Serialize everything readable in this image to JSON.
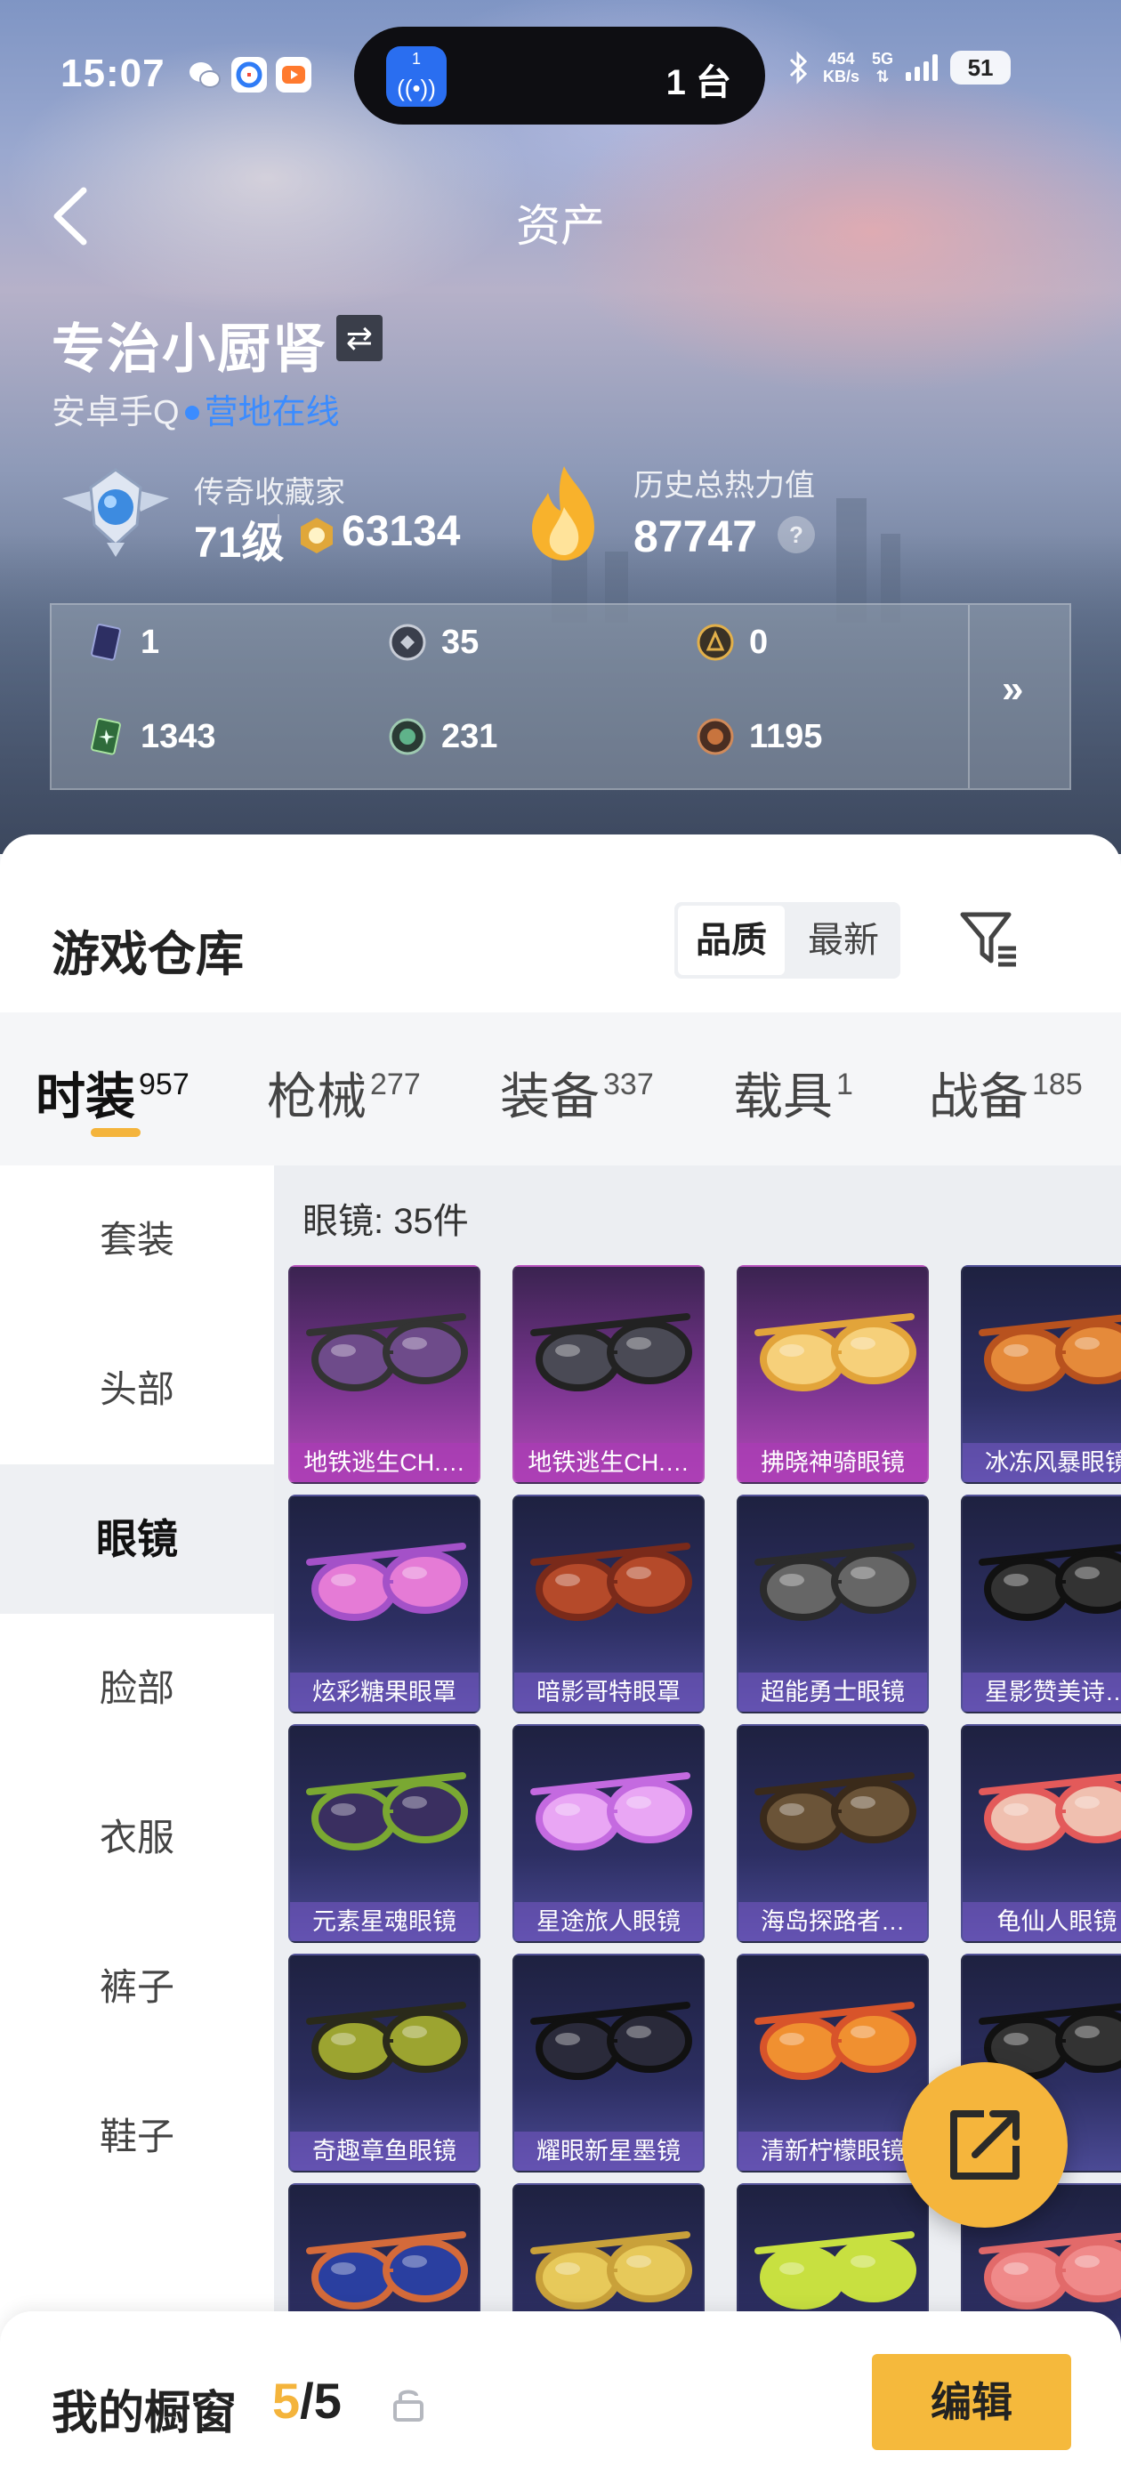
{
  "status_bar": {
    "time": "15:07",
    "island_badge": "1",
    "island_text": "1 台",
    "net_speed_value": "454",
    "net_speed_unit": "KB/s",
    "network": "5G",
    "battery": "51"
  },
  "header": {
    "title": "资产"
  },
  "profile": {
    "name": "专治小厨肾",
    "platform": "安卓手Q",
    "status": "营地在线",
    "rank_title": "传奇收藏家",
    "level": "71级",
    "coins": "63134",
    "heat_label": "历史总热力值",
    "heat_value": "87747",
    "help": "?"
  },
  "stats": [
    {
      "icon": "card-icon",
      "value": "1"
    },
    {
      "icon": "token-silver-icon",
      "value": "35"
    },
    {
      "icon": "token-gold-icon",
      "value": "0"
    },
    {
      "icon": "ticket-green-icon",
      "value": "1343"
    },
    {
      "icon": "orb-green-icon",
      "value": "231"
    },
    {
      "icon": "orb-bronze-icon",
      "value": "1195"
    }
  ],
  "stats_more": "»",
  "warehouse": {
    "title": "游戏仓库",
    "sort_options": [
      "品质",
      "最新"
    ],
    "active_sort": "品质"
  },
  "tabs": [
    {
      "label": "时装",
      "count": "957"
    },
    {
      "label": "枪械",
      "count": "277"
    },
    {
      "label": "装备",
      "count": "337"
    },
    {
      "label": "载具",
      "count": "1"
    },
    {
      "label": "战备",
      "count": "185"
    }
  ],
  "side_categories": [
    "套装",
    "头部",
    "眼镜",
    "脸部",
    "衣服",
    "裤子",
    "鞋子"
  ],
  "active_category": "眼镜",
  "grid_title": "眼镜: 35件",
  "items": [
    {
      "name": "地铁逃生CH.…",
      "rarity": "pink"
    },
    {
      "name": "地铁逃生CH.…",
      "rarity": "pink"
    },
    {
      "name": "拂晓神骑眼镜",
      "rarity": "pink"
    },
    {
      "name": "冰冻风暴眼镜",
      "rarity": "purple"
    },
    {
      "name": "炫彩糖果眼罩",
      "rarity": "purple"
    },
    {
      "name": "暗影哥特眼罩",
      "rarity": "purple"
    },
    {
      "name": "超能勇士眼镜",
      "rarity": "purple"
    },
    {
      "name": "星影赞美诗…",
      "rarity": "purple"
    },
    {
      "name": "元素星魂眼镜",
      "rarity": "purple"
    },
    {
      "name": "星途旅人眼镜",
      "rarity": "purple"
    },
    {
      "name": "海岛探路者…",
      "rarity": "purple"
    },
    {
      "name": "龟仙人眼镜",
      "rarity": "purple"
    },
    {
      "name": "奇趣章鱼眼镜",
      "rarity": "purple"
    },
    {
      "name": "耀眼新星墨镜",
      "rarity": "purple"
    },
    {
      "name": "清新柠檬眼镜",
      "rarity": "purple"
    },
    {
      "name": "",
      "rarity": "purple"
    },
    {
      "name": "",
      "rarity": "purple"
    },
    {
      "name": "",
      "rarity": "purple"
    },
    {
      "name": "",
      "rarity": "purple"
    },
    {
      "name": "",
      "rarity": "purple"
    }
  ],
  "showcase": {
    "title": "我的橱窗",
    "current": "5",
    "total": "/5",
    "edit_label": "编辑"
  },
  "colors": {
    "accent": "#f4b43c",
    "online_blue": "#3b8cff",
    "rarity_pink": "#b64aba",
    "rarity_purple": "#4b4a95"
  }
}
